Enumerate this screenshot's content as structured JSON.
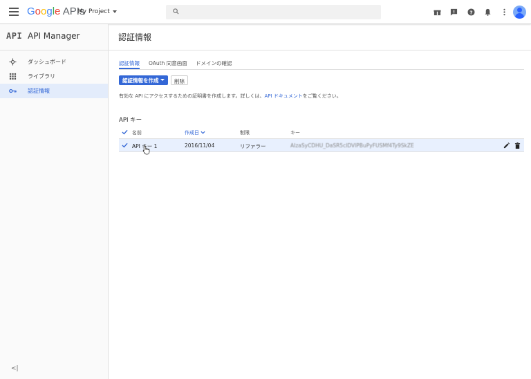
{
  "topbar": {
    "logo_google": [
      "G",
      "o",
      "o",
      "g",
      "l",
      "e"
    ],
    "logo_apis": "APIs",
    "project": "My Project",
    "search_placeholder": "",
    "icons": [
      "gift-icon",
      "feedback-icon",
      "help-icon",
      "notifications-icon",
      "more-vert-icon",
      "avatar"
    ]
  },
  "sidebar": {
    "badge": "API",
    "title": "API Manager",
    "items": [
      {
        "label": "ダッシュボード",
        "icon": "dashboard-icon"
      },
      {
        "label": "ライブラリ",
        "icon": "library-icon"
      },
      {
        "label": "認証情報",
        "icon": "key-icon",
        "active": true
      }
    ],
    "collapse_label": "<|"
  },
  "main": {
    "title": "認証情報",
    "tabs": [
      {
        "label": "認証情報",
        "active": true
      },
      {
        "label": "OAuth 同意画面"
      },
      {
        "label": "ドメインの確認"
      }
    ],
    "create_button": "認証情報を作成",
    "delete_button": "削除",
    "description_prefix": "有効な API にアクセスするための証明書を作成します。詳しくは、",
    "description_link": "API ドキュメント",
    "description_suffix": "をご覧ください。",
    "section_title": "API キー",
    "table": {
      "headers": {
        "name": "名前",
        "created": "作成日",
        "restriction": "制限",
        "key": "キー"
      },
      "rows": [
        {
          "name": "API キー 1",
          "created": "2016/11/04",
          "restriction": "リファラー",
          "key": "AIzaSyCDHU_DaSR5cIDVlPBuPyFUSMf4Ty9SkZE"
        }
      ]
    }
  },
  "colors": {
    "accent": "#3367d6",
    "selected_row": "#e8f0fe",
    "sidebar_active": "#e3ecfb"
  }
}
